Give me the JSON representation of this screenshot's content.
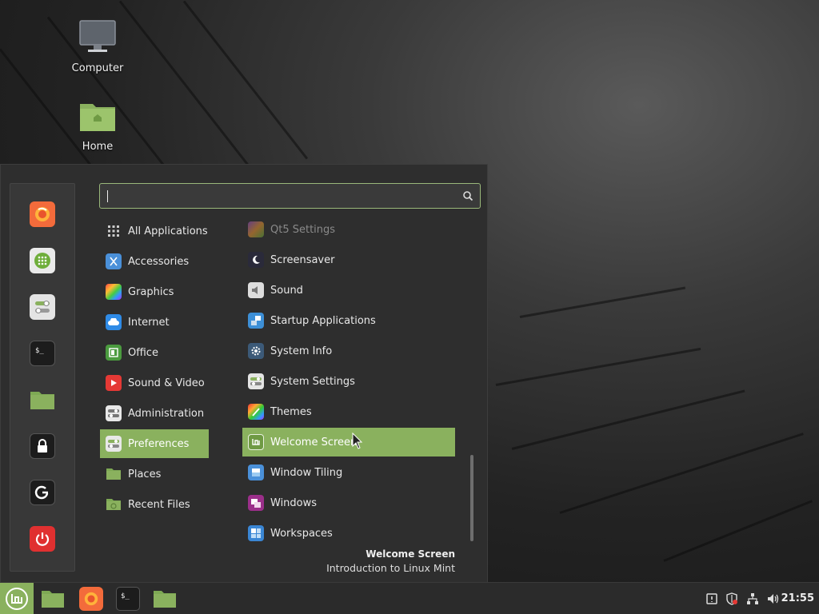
{
  "desktop": {
    "icons": [
      {
        "label": "Computer",
        "icon": "monitor-icon"
      },
      {
        "label": "Home",
        "icon": "home-folder-icon"
      }
    ]
  },
  "menu": {
    "search": {
      "value": "",
      "placeholder": "",
      "icon": "search-icon"
    },
    "favorites": [
      {
        "name": "Firefox",
        "icon": "firefox-icon"
      },
      {
        "name": "Software Manager",
        "icon": "software-manager-icon"
      },
      {
        "name": "System Settings",
        "icon": "system-settings-icon"
      },
      {
        "name": "Terminal",
        "icon": "terminal-icon"
      },
      {
        "name": "Files",
        "icon": "folder-icon"
      },
      {
        "name": "Lock Screen",
        "icon": "lock-icon"
      },
      {
        "name": "Log Out",
        "icon": "logout-icon"
      },
      {
        "name": "Quit",
        "icon": "power-icon"
      }
    ],
    "categories": [
      {
        "label": "All Applications",
        "icon": "grid-icon"
      },
      {
        "label": "Accessories",
        "icon": "accessories-icon"
      },
      {
        "label": "Graphics",
        "icon": "graphics-icon"
      },
      {
        "label": "Internet",
        "icon": "cloud-icon"
      },
      {
        "label": "Office",
        "icon": "office-icon"
      },
      {
        "label": "Sound & Video",
        "icon": "play-icon"
      },
      {
        "label": "Administration",
        "icon": "administration-icon"
      },
      {
        "label": "Preferences",
        "icon": "preferences-icon",
        "selected": true
      },
      {
        "label": "Places",
        "icon": "folder-icon"
      },
      {
        "label": "Recent Files",
        "icon": "recent-folder-icon"
      }
    ],
    "apps": [
      {
        "label": "Qt5 Settings",
        "icon": "qt5-settings-icon",
        "dim": true
      },
      {
        "label": "Screensaver",
        "icon": "moon-icon"
      },
      {
        "label": "Sound",
        "icon": "speaker-icon"
      },
      {
        "label": "Startup Applications",
        "icon": "startup-icon"
      },
      {
        "label": "System Info",
        "icon": "gear-icon"
      },
      {
        "label": "System Settings",
        "icon": "system-settings-icon"
      },
      {
        "label": "Themes",
        "icon": "themes-icon"
      },
      {
        "label": "Welcome Screen",
        "icon": "mint-icon",
        "selected": true
      },
      {
        "label": "Window Tiling",
        "icon": "window-tiling-icon"
      },
      {
        "label": "Windows",
        "icon": "windows-icon"
      },
      {
        "label": "Workspaces",
        "icon": "workspaces-icon"
      }
    ],
    "description": {
      "title": "Welcome Screen",
      "text": "Introduction to Linux Mint"
    }
  },
  "panel": {
    "menu_button_icon": "mint-logo-icon",
    "tasks": [
      {
        "name": "Files",
        "icon": "folder-icon"
      },
      {
        "name": "Firefox",
        "icon": "firefox-icon"
      },
      {
        "name": "Terminal",
        "icon": "terminal-icon"
      },
      {
        "name": "Files",
        "icon": "folder-icon"
      }
    ],
    "tray": [
      "notification-icon",
      "update-shield-icon",
      "network-icon",
      "volume-icon"
    ],
    "clock": "21:55"
  },
  "colors": {
    "accent": "#8ab15e",
    "menu_bg": "#2e2e2e",
    "panel_bg": "#2b2b2b"
  }
}
